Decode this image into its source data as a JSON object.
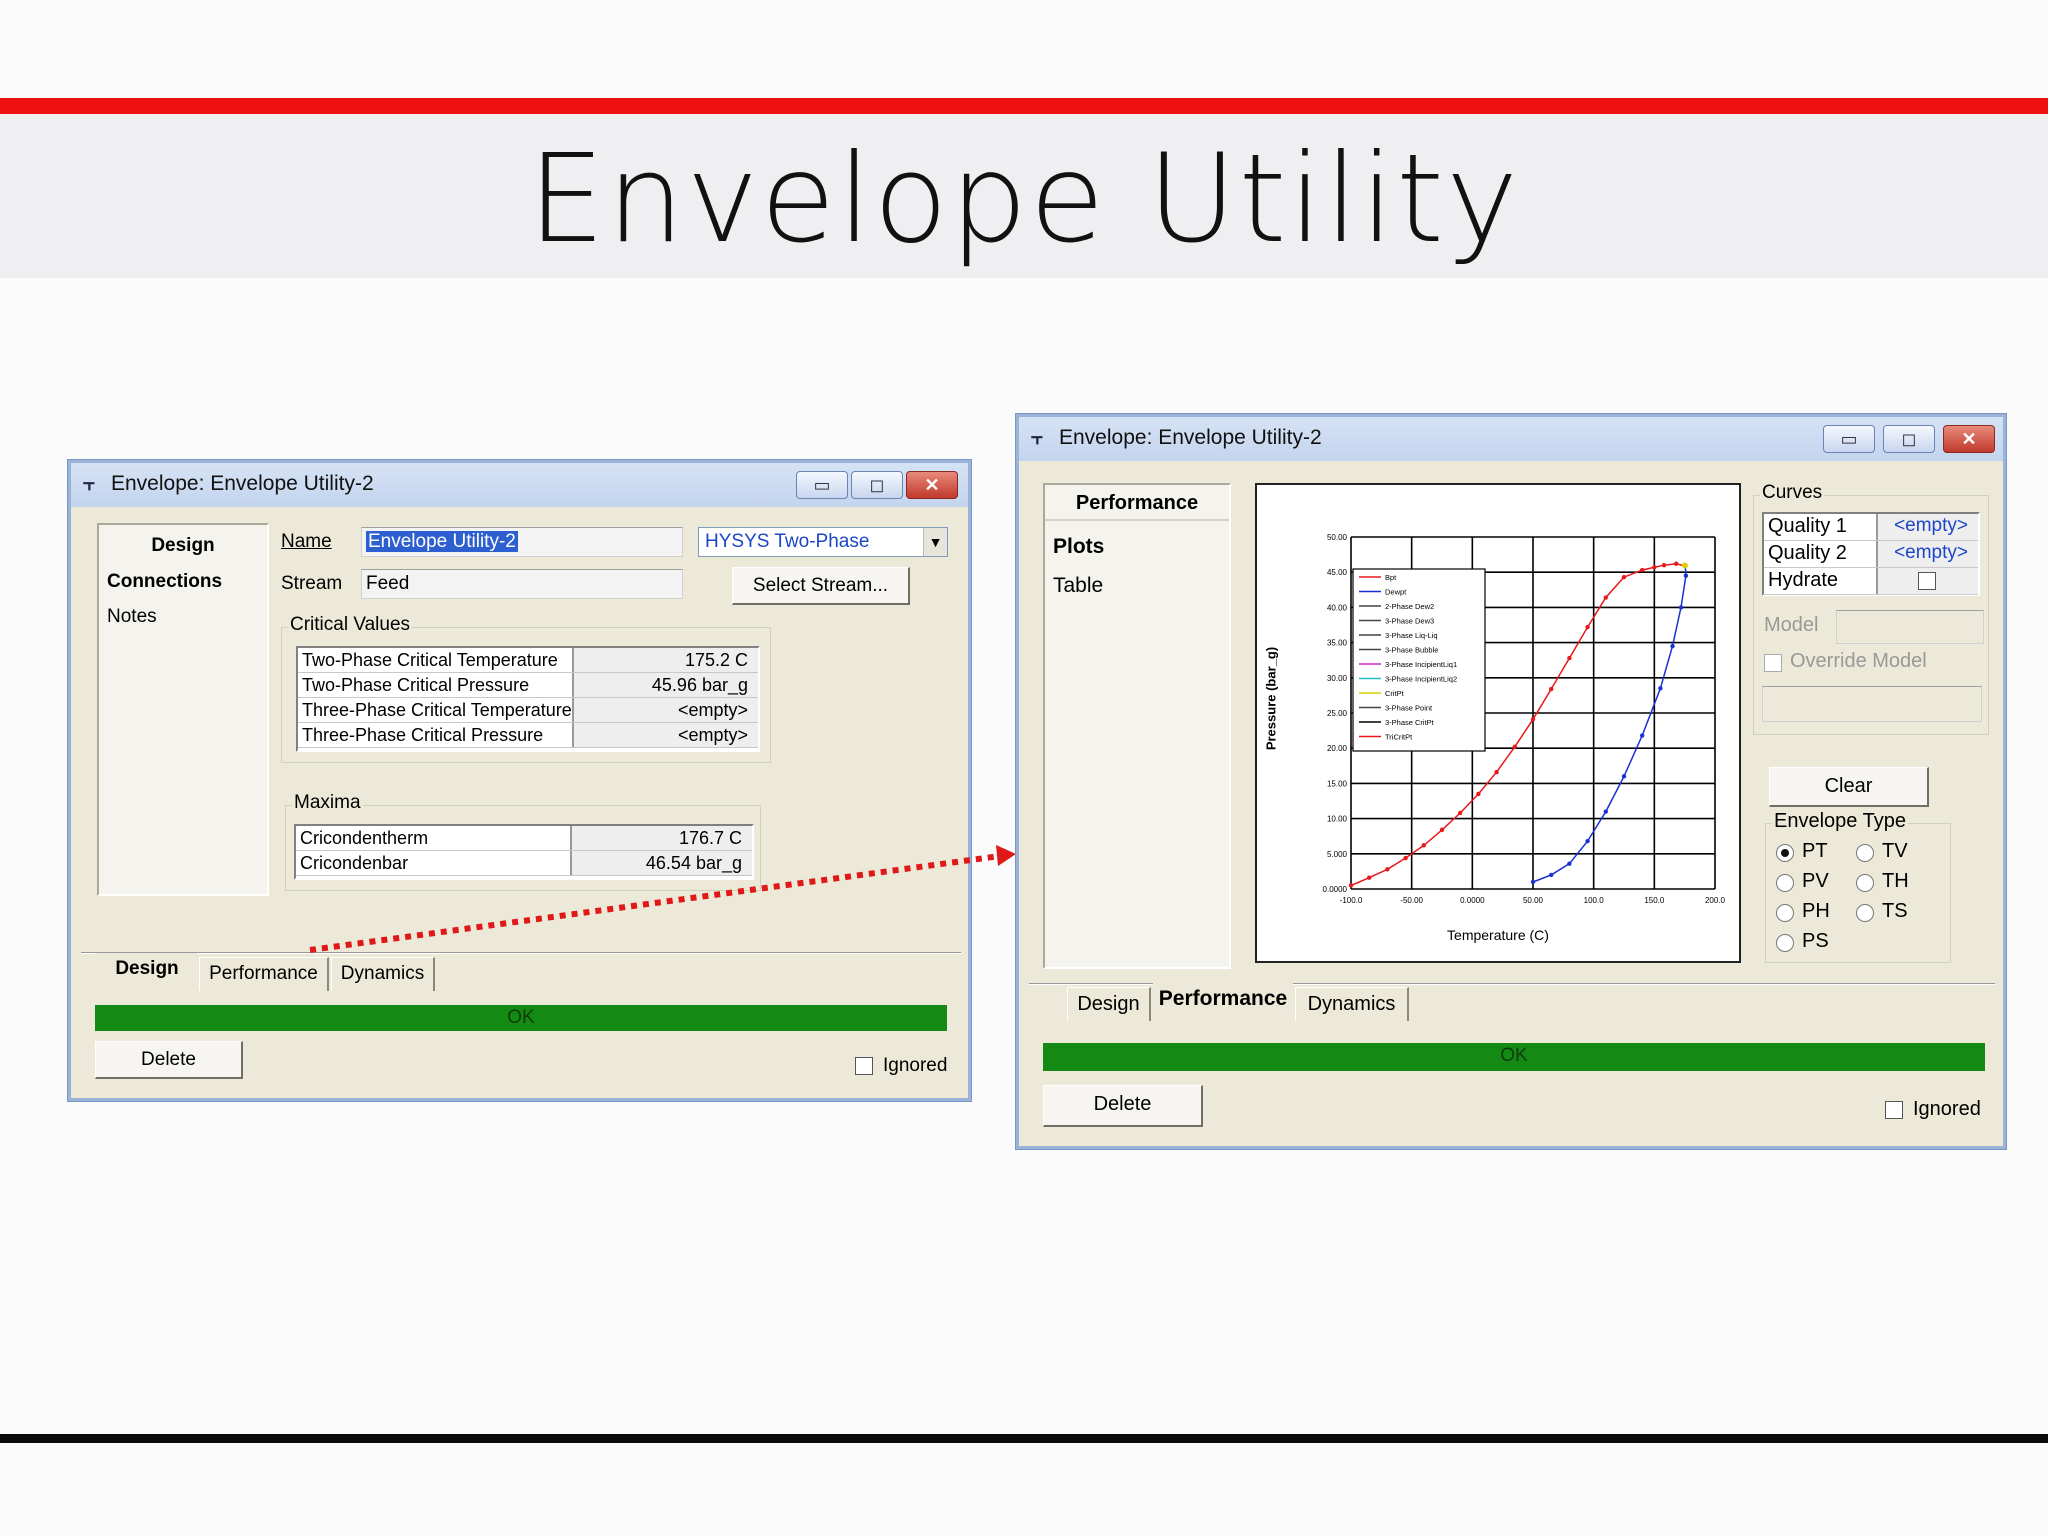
{
  "slide": {
    "title": "Envelope Utility"
  },
  "left_window": {
    "title": "Envelope: Envelope Utility-2",
    "nav": {
      "items": [
        "Design",
        "Connections",
        "Notes"
      ]
    },
    "name_label": "Name",
    "name_value": "Envelope Utility-2",
    "property_package": "HYSYS Two-Phase",
    "stream_label": "Stream",
    "stream_value": "Feed",
    "select_stream_button": "Select Stream...",
    "critical_values": {
      "title": "Critical Values",
      "rows": [
        {
          "label": "Two-Phase Critical Temperature",
          "value": "175.2 C"
        },
        {
          "label": "Two-Phase Critical Pressure",
          "value": "45.96 bar_g"
        },
        {
          "label": "Three-Phase Critical Temperature",
          "value": "<empty>"
        },
        {
          "label": "Three-Phase Critical Pressure",
          "value": "<empty>"
        }
      ]
    },
    "maxima": {
      "title": "Maxima",
      "rows": [
        {
          "label": "Cricondentherm",
          "value": "176.7 C"
        },
        {
          "label": "Cricondenbar",
          "value": "46.54 bar_g"
        }
      ]
    },
    "tabs": [
      "Design",
      "Performance",
      "Dynamics"
    ],
    "active_tab": "Design",
    "status": "OK",
    "delete_button": "Delete",
    "ignored_label": "Ignored"
  },
  "right_window": {
    "title": "Envelope: Envelope Utility-2",
    "nav": {
      "header": "Performance",
      "items": [
        "Plots",
        "Table"
      ]
    },
    "curves": {
      "title": "Curves",
      "rows": [
        {
          "label": "Quality 1",
          "value": "<empty>"
        },
        {
          "label": "Quality 2",
          "value": "<empty>"
        },
        {
          "label": "Hydrate",
          "value": ""
        }
      ]
    },
    "model_label": "Model",
    "override_model_label": "Override Model",
    "clear_button": "Clear",
    "envelope_type": {
      "title": "Envelope Type",
      "options": [
        "PT",
        "TV",
        "PV",
        "TH",
        "PH",
        "TS",
        "PS"
      ],
      "selected": "PT"
    },
    "tabs": [
      "Design",
      "Performance",
      "Dynamics"
    ],
    "active_tab": "Performance",
    "status": "OK",
    "delete_button": "Delete",
    "ignored_label": "Ignored"
  },
  "chart_data": {
    "type": "line",
    "xlabel": "Temperature (C)",
    "ylabel": "Pressure (bar_g)",
    "xlim": [
      -100,
      200
    ],
    "ylim": [
      0,
      50
    ],
    "x_ticks": [
      "-100.0",
      "-50.00",
      "0.0000",
      "50.00",
      "100.0",
      "150.0",
      "200.0"
    ],
    "y_ticks": [
      "0.0000",
      "5.000",
      "10.00",
      "15.00",
      "20.00",
      "25.00",
      "30.00",
      "35.00",
      "40.00",
      "45.00",
      "50.00"
    ],
    "grid": true,
    "legend_position": "top-left",
    "legend": [
      "Bpt",
      "Dewpt",
      "2-Phase Dew2",
      "3-Phase Dew3",
      "3-Phase Liq-Liq",
      "3-Phase Bubble",
      "3-Phase IncipientLiq1",
      "3-Phase IncipientLiq2",
      "CritPt",
      "3-Phase Point",
      "3-Phase CritPt",
      "TriCritPt"
    ],
    "series": [
      {
        "name": "Bpt",
        "color": "#e8181b",
        "points": [
          [
            -100,
            0.5
          ],
          [
            -85,
            1.6
          ],
          [
            -70,
            2.8
          ],
          [
            -55,
            4.4
          ],
          [
            -40,
            6.2
          ],
          [
            -25,
            8.4
          ],
          [
            -10,
            10.8
          ],
          [
            5,
            13.5
          ],
          [
            20,
            16.6
          ],
          [
            35,
            20.2
          ],
          [
            50,
            24.1
          ],
          [
            65,
            28.4
          ],
          [
            80,
            32.8
          ],
          [
            95,
            37.2
          ],
          [
            110,
            41.4
          ],
          [
            125,
            44.3
          ],
          [
            140,
            45.3
          ],
          [
            150,
            45.7
          ],
          [
            158,
            46.0
          ],
          [
            168,
            46.2
          ],
          [
            175,
            45.9
          ]
        ]
      },
      {
        "name": "Dewpt",
        "color": "#1a2fd4",
        "points": [
          [
            50,
            1.0
          ],
          [
            65,
            2.0
          ],
          [
            80,
            3.6
          ],
          [
            95,
            6.8
          ],
          [
            110,
            11.0
          ],
          [
            125,
            16.0
          ],
          [
            140,
            21.8
          ],
          [
            155,
            28.5
          ],
          [
            165,
            34.5
          ],
          [
            172,
            40.0
          ],
          [
            176,
            44.5
          ],
          [
            175.5,
            45.9
          ]
        ]
      }
    ]
  }
}
